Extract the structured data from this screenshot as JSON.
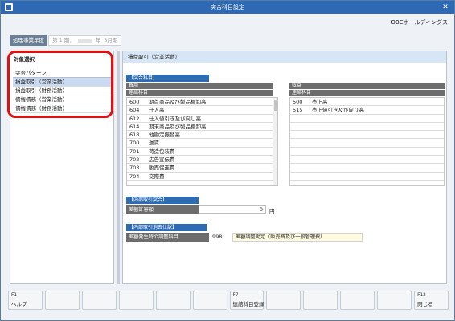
{
  "window": {
    "title": "突合科目設定",
    "company": "OBCホールディングス"
  },
  "year": {
    "label": "処理事業年度",
    "period": "第 1 期：",
    "year_suffix": "年",
    "month": "3月期"
  },
  "left_panel": {
    "heading": "対象選択",
    "items": [
      {
        "label": "突合パターン",
        "selected": false
      },
      {
        "label": "損益取引（営業活動）",
        "selected": true
      },
      {
        "label": "損益取引（財務活動）",
        "selected": false
      },
      {
        "label": "債権債務（営業活動）",
        "selected": false
      },
      {
        "label": "債権債務（財務活動）",
        "selected": false
      }
    ]
  },
  "right_panel": {
    "heading": "損益取引（営業活動）",
    "section_tag": "【突合科目】",
    "expense": {
      "header": "費用",
      "subheader": "連結科目",
      "rows": [
        {
          "code": "600",
          "name": "期首商品及び製品棚卸高"
        },
        {
          "code": "604",
          "name": "仕入高"
        },
        {
          "code": "612",
          "name": "仕入値引き及び戻し高"
        },
        {
          "code": "614",
          "name": "期末商品及び製品棚卸高"
        },
        {
          "code": "618",
          "name": "他勘定振替高"
        },
        {
          "code": "700",
          "name": "運賃"
        },
        {
          "code": "701",
          "name": "荷造包装費"
        },
        {
          "code": "702",
          "name": "広告宣伝費"
        },
        {
          "code": "703",
          "name": "販売促進費"
        },
        {
          "code": "704",
          "name": "交際費"
        }
      ]
    },
    "revenue": {
      "header": "収益",
      "subheader": "連結科目",
      "rows": [
        {
          "code": "500",
          "name": "売上高"
        },
        {
          "code": "515",
          "name": "売上値引き及び戻り高"
        }
      ]
    },
    "internal_match": {
      "tag": "【内部取引突合】",
      "label": "差額許容額",
      "value": "0",
      "unit": "円"
    },
    "internal_elim": {
      "tag": "【内部取引消去仕訳】",
      "label": "差額発生時の調整科目",
      "code": "998",
      "name": "差額調整勘定（販売費及び一般管理費）"
    }
  },
  "fkeys": [
    {
      "num": "F1",
      "label": "ヘルプ"
    },
    {
      "num": "",
      "label": ""
    },
    {
      "num": "",
      "label": ""
    },
    {
      "num": "",
      "label": ""
    },
    {
      "num": "",
      "label": ""
    },
    {
      "num": "",
      "label": ""
    },
    {
      "num": "F7",
      "label": "連結科目登録"
    },
    {
      "num": "",
      "label": ""
    },
    {
      "num": "",
      "label": ""
    },
    {
      "num": "",
      "label": ""
    },
    {
      "num": "",
      "label": ""
    },
    {
      "num": "F12",
      "label": "閉じる"
    }
  ],
  "colors": {
    "titlebar": "#2e6ab3",
    "highlight": "#e01010",
    "tag": "#2d6bb5",
    "selected": "#c9daf1"
  }
}
